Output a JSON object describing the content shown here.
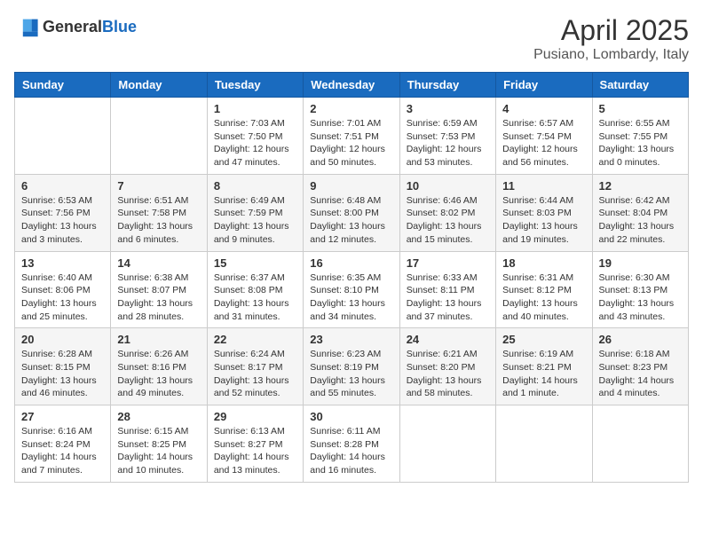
{
  "logo": {
    "general": "General",
    "blue": "Blue"
  },
  "header": {
    "month": "April 2025",
    "location": "Pusiano, Lombardy, Italy"
  },
  "weekdays": [
    "Sunday",
    "Monday",
    "Tuesday",
    "Wednesday",
    "Thursday",
    "Friday",
    "Saturday"
  ],
  "weeks": [
    [
      null,
      null,
      {
        "day": "1",
        "sunrise": "Sunrise: 7:03 AM",
        "sunset": "Sunset: 7:50 PM",
        "daylight": "Daylight: 12 hours and 47 minutes."
      },
      {
        "day": "2",
        "sunrise": "Sunrise: 7:01 AM",
        "sunset": "Sunset: 7:51 PM",
        "daylight": "Daylight: 12 hours and 50 minutes."
      },
      {
        "day": "3",
        "sunrise": "Sunrise: 6:59 AM",
        "sunset": "Sunset: 7:53 PM",
        "daylight": "Daylight: 12 hours and 53 minutes."
      },
      {
        "day": "4",
        "sunrise": "Sunrise: 6:57 AM",
        "sunset": "Sunset: 7:54 PM",
        "daylight": "Daylight: 12 hours and 56 minutes."
      },
      {
        "day": "5",
        "sunrise": "Sunrise: 6:55 AM",
        "sunset": "Sunset: 7:55 PM",
        "daylight": "Daylight: 13 hours and 0 minutes."
      }
    ],
    [
      {
        "day": "6",
        "sunrise": "Sunrise: 6:53 AM",
        "sunset": "Sunset: 7:56 PM",
        "daylight": "Daylight: 13 hours and 3 minutes."
      },
      {
        "day": "7",
        "sunrise": "Sunrise: 6:51 AM",
        "sunset": "Sunset: 7:58 PM",
        "daylight": "Daylight: 13 hours and 6 minutes."
      },
      {
        "day": "8",
        "sunrise": "Sunrise: 6:49 AM",
        "sunset": "Sunset: 7:59 PM",
        "daylight": "Daylight: 13 hours and 9 minutes."
      },
      {
        "day": "9",
        "sunrise": "Sunrise: 6:48 AM",
        "sunset": "Sunset: 8:00 PM",
        "daylight": "Daylight: 13 hours and 12 minutes."
      },
      {
        "day": "10",
        "sunrise": "Sunrise: 6:46 AM",
        "sunset": "Sunset: 8:02 PM",
        "daylight": "Daylight: 13 hours and 15 minutes."
      },
      {
        "day": "11",
        "sunrise": "Sunrise: 6:44 AM",
        "sunset": "Sunset: 8:03 PM",
        "daylight": "Daylight: 13 hours and 19 minutes."
      },
      {
        "day": "12",
        "sunrise": "Sunrise: 6:42 AM",
        "sunset": "Sunset: 8:04 PM",
        "daylight": "Daylight: 13 hours and 22 minutes."
      }
    ],
    [
      {
        "day": "13",
        "sunrise": "Sunrise: 6:40 AM",
        "sunset": "Sunset: 8:06 PM",
        "daylight": "Daylight: 13 hours and 25 minutes."
      },
      {
        "day": "14",
        "sunrise": "Sunrise: 6:38 AM",
        "sunset": "Sunset: 8:07 PM",
        "daylight": "Daylight: 13 hours and 28 minutes."
      },
      {
        "day": "15",
        "sunrise": "Sunrise: 6:37 AM",
        "sunset": "Sunset: 8:08 PM",
        "daylight": "Daylight: 13 hours and 31 minutes."
      },
      {
        "day": "16",
        "sunrise": "Sunrise: 6:35 AM",
        "sunset": "Sunset: 8:10 PM",
        "daylight": "Daylight: 13 hours and 34 minutes."
      },
      {
        "day": "17",
        "sunrise": "Sunrise: 6:33 AM",
        "sunset": "Sunset: 8:11 PM",
        "daylight": "Daylight: 13 hours and 37 minutes."
      },
      {
        "day": "18",
        "sunrise": "Sunrise: 6:31 AM",
        "sunset": "Sunset: 8:12 PM",
        "daylight": "Daylight: 13 hours and 40 minutes."
      },
      {
        "day": "19",
        "sunrise": "Sunrise: 6:30 AM",
        "sunset": "Sunset: 8:13 PM",
        "daylight": "Daylight: 13 hours and 43 minutes."
      }
    ],
    [
      {
        "day": "20",
        "sunrise": "Sunrise: 6:28 AM",
        "sunset": "Sunset: 8:15 PM",
        "daylight": "Daylight: 13 hours and 46 minutes."
      },
      {
        "day": "21",
        "sunrise": "Sunrise: 6:26 AM",
        "sunset": "Sunset: 8:16 PM",
        "daylight": "Daylight: 13 hours and 49 minutes."
      },
      {
        "day": "22",
        "sunrise": "Sunrise: 6:24 AM",
        "sunset": "Sunset: 8:17 PM",
        "daylight": "Daylight: 13 hours and 52 minutes."
      },
      {
        "day": "23",
        "sunrise": "Sunrise: 6:23 AM",
        "sunset": "Sunset: 8:19 PM",
        "daylight": "Daylight: 13 hours and 55 minutes."
      },
      {
        "day": "24",
        "sunrise": "Sunrise: 6:21 AM",
        "sunset": "Sunset: 8:20 PM",
        "daylight": "Daylight: 13 hours and 58 minutes."
      },
      {
        "day": "25",
        "sunrise": "Sunrise: 6:19 AM",
        "sunset": "Sunset: 8:21 PM",
        "daylight": "Daylight: 14 hours and 1 minute."
      },
      {
        "day": "26",
        "sunrise": "Sunrise: 6:18 AM",
        "sunset": "Sunset: 8:23 PM",
        "daylight": "Daylight: 14 hours and 4 minutes."
      }
    ],
    [
      {
        "day": "27",
        "sunrise": "Sunrise: 6:16 AM",
        "sunset": "Sunset: 8:24 PM",
        "daylight": "Daylight: 14 hours and 7 minutes."
      },
      {
        "day": "28",
        "sunrise": "Sunrise: 6:15 AM",
        "sunset": "Sunset: 8:25 PM",
        "daylight": "Daylight: 14 hours and 10 minutes."
      },
      {
        "day": "29",
        "sunrise": "Sunrise: 6:13 AM",
        "sunset": "Sunset: 8:27 PM",
        "daylight": "Daylight: 14 hours and 13 minutes."
      },
      {
        "day": "30",
        "sunrise": "Sunrise: 6:11 AM",
        "sunset": "Sunset: 8:28 PM",
        "daylight": "Daylight: 14 hours and 16 minutes."
      },
      null,
      null,
      null
    ]
  ]
}
